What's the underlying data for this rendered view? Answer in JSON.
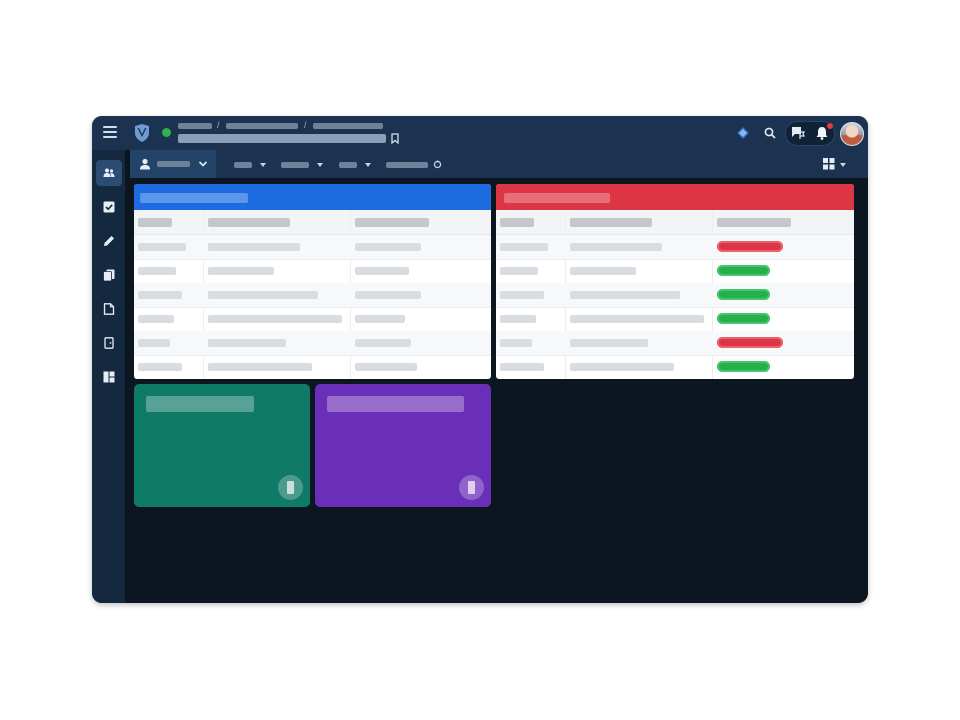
{
  "colors": {
    "window_bg": "#0b1621",
    "topbar": "#1b3350",
    "sidebar": "#14283f",
    "panel_left_header": "#1e6be0",
    "panel_right_header": "#dc3545",
    "tile_teal": "#0f7a66",
    "tile_purple": "#6a2fb8",
    "status_online": "#2fb34a",
    "badge_red": "#dc3545",
    "badge_green": "#22b14c"
  },
  "topbar": {
    "menu_icon": "hamburger-icon",
    "logo": "shield-logo",
    "status": "online",
    "breadcrumb_separator": "/",
    "right_icons": [
      "diamond-icon",
      "search-icon",
      "chat-flag-icon",
      "bell-icon",
      "avatar"
    ]
  },
  "sidebar": {
    "items": [
      {
        "icon": "people-icon",
        "active": true
      },
      {
        "icon": "checkbox-icon",
        "active": false
      },
      {
        "icon": "pencil-icon",
        "active": false
      },
      {
        "icon": "documents-icon",
        "active": false
      },
      {
        "icon": "file-icon",
        "active": false
      },
      {
        "icon": "door-exit-icon",
        "active": false
      },
      {
        "icon": "dashboard-icon",
        "active": false
      }
    ]
  },
  "subbar": {
    "user_tab_icon": "user-icon",
    "user_tab_chevron": "chevron-down-icon",
    "menus": 4,
    "layout_icon": "layout-grid-icon"
  },
  "panels": [
    {
      "header_color": "#1e6be0",
      "rows": 6,
      "status_badges": []
    },
    {
      "header_color": "#dc3545",
      "rows": 6,
      "status_badges": [
        "red",
        "green",
        "green",
        "green",
        "red",
        "green"
      ]
    }
  ],
  "tiles": [
    {
      "color": "#0f7a66",
      "icon": "document-icon"
    },
    {
      "color": "#6a2fb8",
      "icon": "document-icon"
    }
  ]
}
